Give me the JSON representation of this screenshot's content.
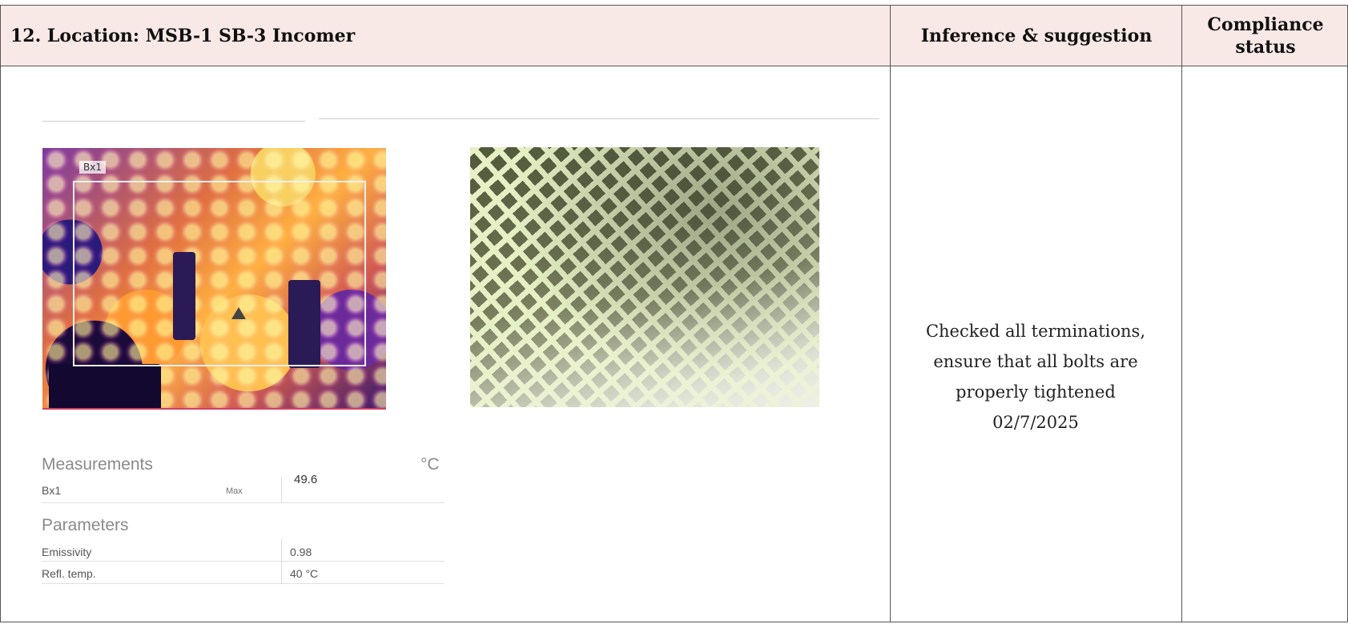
{
  "header": {
    "location": "12. Location: MSB-1 SB-3 Incomer",
    "inference_heading": "Inference & suggestion",
    "compliance_heading_line1": "Compliance",
    "compliance_heading_line2": "status"
  },
  "thermal_image": {
    "box_label": "Bx1"
  },
  "measurements": {
    "title": "Measurements",
    "unit": "°C",
    "rows": [
      {
        "name": "Bx1",
        "stat": "Max",
        "value": "49.6"
      }
    ]
  },
  "parameters": {
    "title": "Parameters",
    "rows": [
      {
        "name": "Emissivity",
        "value": "0.98"
      },
      {
        "name": "Refl. temp.",
        "value": "40 °C"
      }
    ]
  },
  "inference": {
    "lines": [
      "Checked all terminations,",
      "ensure that all bolts are",
      "properly tightened",
      "02/7/2025"
    ]
  },
  "compliance": {
    "status": ""
  }
}
